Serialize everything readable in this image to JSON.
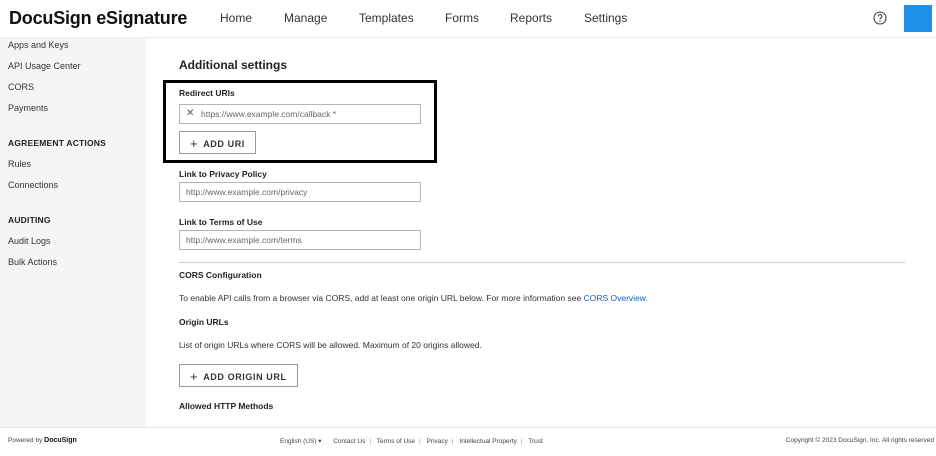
{
  "header": {
    "logo": "DocuSign eSignature",
    "nav": [
      "Home",
      "Manage",
      "Templates",
      "Forms",
      "Reports",
      "Settings"
    ],
    "help_icon": "help-circle-icon",
    "avatar_color": "#1e90e8"
  },
  "sidebar": {
    "items_top": [
      "Apps and Keys",
      "API Usage Center",
      "CORS",
      "Payments"
    ],
    "agreement_heading": "AGREEMENT ACTIONS",
    "agreement_items": [
      "Rules",
      "Connections"
    ],
    "auditing_heading": "AUDITING",
    "auditing_items": [
      "Audit Logs",
      "Bulk Actions"
    ]
  },
  "main": {
    "section_title": "Additional settings",
    "redirect": {
      "label": "Redirect URIs",
      "uri_value": "https://www.example.com/callback *",
      "remove_icon": "close-icon",
      "add_button": "ADD URI"
    },
    "privacy": {
      "label": "Link to Privacy Policy",
      "value": "http://www.example.com/privacy"
    },
    "terms": {
      "label": "Link to Terms of Use",
      "value": "http://www.example.com/terms"
    },
    "cors": {
      "title": "CORS Configuration",
      "description": "To enable API calls from a browser via CORS, add at least one origin URL below. For more information see ",
      "link": "CORS Overview.",
      "origin_title": "Origin URLs",
      "origin_desc": "List of origin URLs where CORS will be allowed. Maximum of 20 origins allowed.",
      "add_origin_button": "ADD ORIGIN URL",
      "methods_title": "Allowed HTTP Methods"
    },
    "accent_link_color": "#1a62b8"
  },
  "footer": {
    "powered_by": "Powered by",
    "powered_brand": "DocuSign",
    "language": "English (US) ▾",
    "links": [
      "Contact Us",
      "Terms of Use",
      "Privacy",
      "Intellectual Property",
      "Trust"
    ],
    "copyright": "Copyright © 2023 DocuSign, Inc. All rights reserved"
  }
}
